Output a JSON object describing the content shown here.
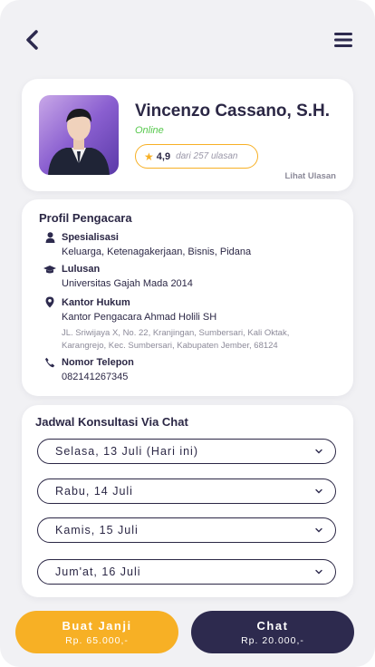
{
  "header": {
    "back_icon": "chevron-left-icon",
    "menu_icon": "hamburger-menu-icon"
  },
  "profile": {
    "name": "Vincenzo Cassano, S.H.",
    "status": "Online",
    "rating": "4,9",
    "reviews": "dari 257 ulasan",
    "see_reviews": "Lihat Ulasan",
    "status_color": "#57c84d",
    "rating_color": "#f7b025"
  },
  "lawyer_profile": {
    "title": "Profil Pengacara",
    "specialization": {
      "label": "Spesialisasi",
      "value": "Keluarga, Ketenagakerjaan, Bisnis, Pidana"
    },
    "education": {
      "label": "Lulusan",
      "value": "Universitas Gajah Mada 2014"
    },
    "office": {
      "label": "Kantor Hukum",
      "value": "Kantor Pengacara Ahmad Holili SH",
      "address_line1": "JL. Sriwijaya X, No. 22, Kranjingan, Sumbersari, Kali Oktak,",
      "address_line2": "Karangrejo, Kec. Sumbersari, Kabupaten Jember, 68124"
    },
    "phone": {
      "label": "Nomor Telepon",
      "value": "082141267345"
    }
  },
  "schedule": {
    "title": "Jadwal Konsultasi Via Chat",
    "days": [
      "Selasa, 13 Juli (Hari ini)",
      "Rabu, 14 Juli",
      "Kamis, 15 Juli",
      "Jum'at, 16 Juli"
    ]
  },
  "actions": {
    "appointment_label": "Buat Janji",
    "appointment_price": "Rp. 65.000,-",
    "chat_label": "Chat",
    "chat_price": "Rp. 20.000,-",
    "accent_color": "#f7b025",
    "dark_color": "#2d2a4e"
  }
}
